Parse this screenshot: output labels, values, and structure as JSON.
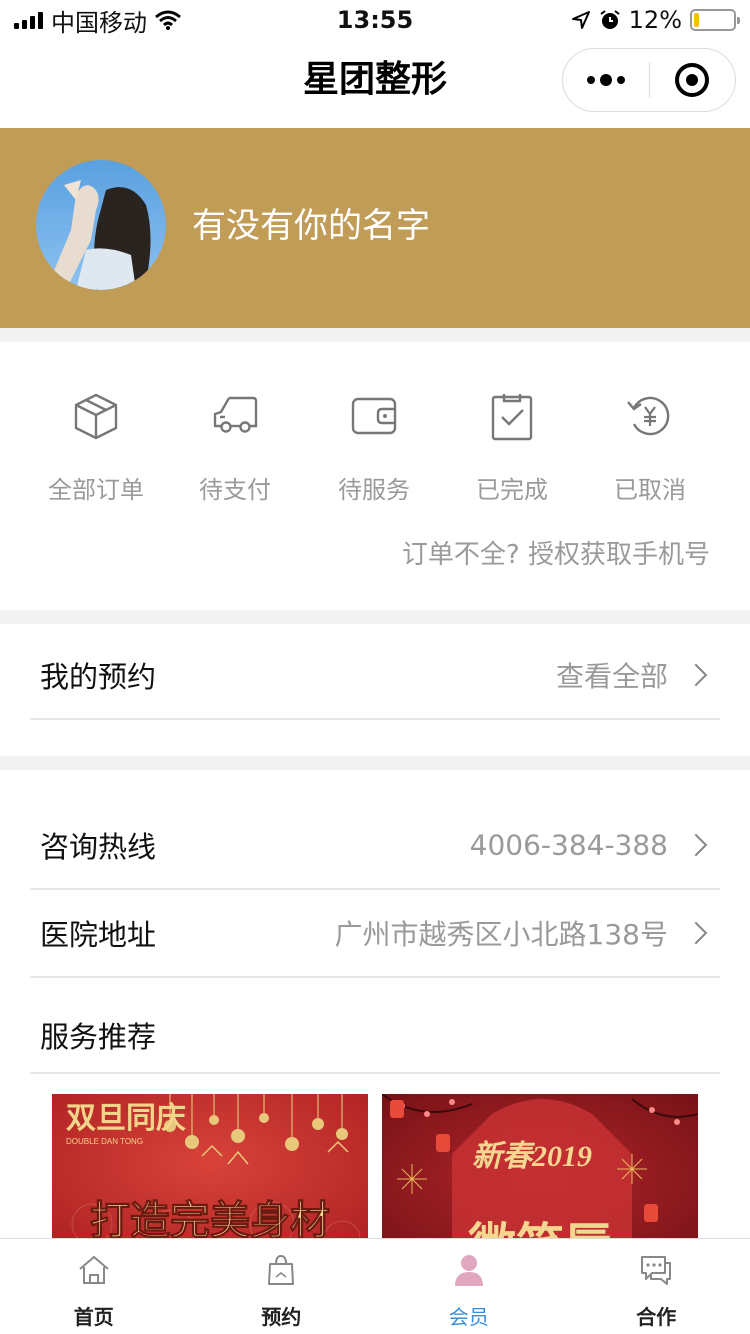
{
  "status_bar": {
    "carrier": "中国移动",
    "time": "13:55",
    "battery": "12%",
    "battery_level": 0.12
  },
  "nav": {
    "title": "星团整形"
  },
  "profile": {
    "name": "有没有你的名字"
  },
  "orders": {
    "items": [
      {
        "label": "全部订单",
        "icon": "package-box-icon"
      },
      {
        "label": "待支付",
        "icon": "delivery-truck-icon"
      },
      {
        "label": "待服务",
        "icon": "wallet-icon"
      },
      {
        "label": "已完成",
        "icon": "clipboard-check-icon"
      },
      {
        "label": "已取消",
        "icon": "refund-yen-icon"
      }
    ],
    "auth_link": "订单不全? 授权获取手机号"
  },
  "appointment": {
    "title": "我的预约",
    "action": "查看全部"
  },
  "info": {
    "hotline": {
      "title": "咨询热线",
      "value": "4006-384-388"
    },
    "address": {
      "title": "医院地址",
      "value": "广州市越秀区小北路138号"
    },
    "recommend_title": "服务推荐"
  },
  "promos": [
    {
      "badge": "双旦同庆",
      "badge_sub": "DOUBLE DAN TONG",
      "headline": "打造完美身材"
    },
    {
      "badge": "新春2019",
      "headline": "微笑唇"
    }
  ],
  "tabs": [
    {
      "label": "首页",
      "icon": "home-icon",
      "active": false
    },
    {
      "label": "预约",
      "icon": "shopping-bag-icon",
      "active": false
    },
    {
      "label": "会员",
      "icon": "user-icon",
      "active": true
    },
    {
      "label": "合作",
      "icon": "chat-icon",
      "active": false
    }
  ],
  "colors": {
    "banner": "#c19c57",
    "active_tab": "#3b8fd8",
    "promo_red": "#b8282a"
  }
}
